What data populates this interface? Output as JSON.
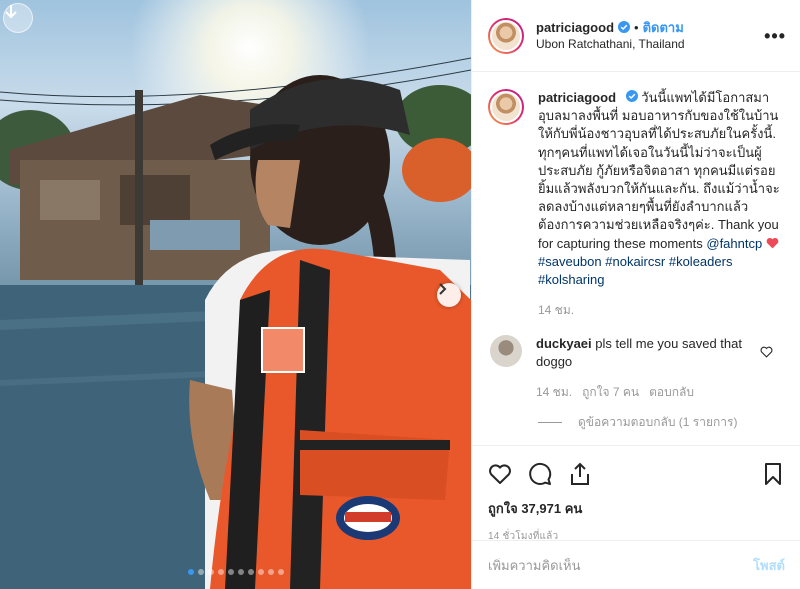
{
  "post": {
    "username": "patriciagood",
    "follow_label": "ติดตาม",
    "separator": "•",
    "location": "Ubon Ratchathani, Thailand",
    "more_label": "•••",
    "caption": {
      "text": "วันนี้แพทได้มีโอกาสมาอุบลมาลงพื้นที่ มอบอาหารกับของใช้ในบ้านให้กับพี่น้องชาวอุบลที่ได้ประสบภัยในครั้งนี้. ทุกๆคนที่แพทได้เจอในวันนี้ไม่ว่าจะเป็นผู้ประสบภัย กู้ภัยหรือจิตอาสา ทุกคนมีแต่รอยยิ้มแล้วพลังบวกให้กันและกัน. ถึงแม้ว่าน้ำจะลดลงบ้างแต่หลายๆพื้นที่ยังลำบากแล้วต้องการความช่วยเหลือจริงๆค่ะ. Thank you for capturing these moments",
      "mention": "@fahntcp",
      "tags": [
        "#saveubon",
        "#nokaircsr",
        "#koleaders",
        "#kolsharing"
      ],
      "age": "14 ชม."
    },
    "comment": {
      "username": "duckyaei",
      "text": "pls tell me you saved that doggo",
      "age": "14 ชม.",
      "likes": "ถูกใจ 7 คน",
      "reply_label": "ตอบกลับ",
      "view_replies": "ดูข้อความตอบกลับ (1 รายการ)"
    },
    "likes_text": "ถูกใจ 37,971 คน",
    "timestamp": "14 ชั่วโมงที่แล้ว",
    "add_comment_placeholder": "เพิ่มความคิดเห็น",
    "post_label": "โพสต์"
  },
  "carousel": {
    "count": 10,
    "active_index": 0
  },
  "colors": {
    "accent": "#3897f0",
    "heart_red": "#ed4956",
    "link_dark": "#003569",
    "muted": "#999999"
  },
  "icons": [
    "download-icon",
    "next-arrow-icon",
    "verified-badge-icon",
    "heart-icon",
    "comment-icon",
    "share-icon",
    "bookmark-icon",
    "more-options-icon"
  ]
}
